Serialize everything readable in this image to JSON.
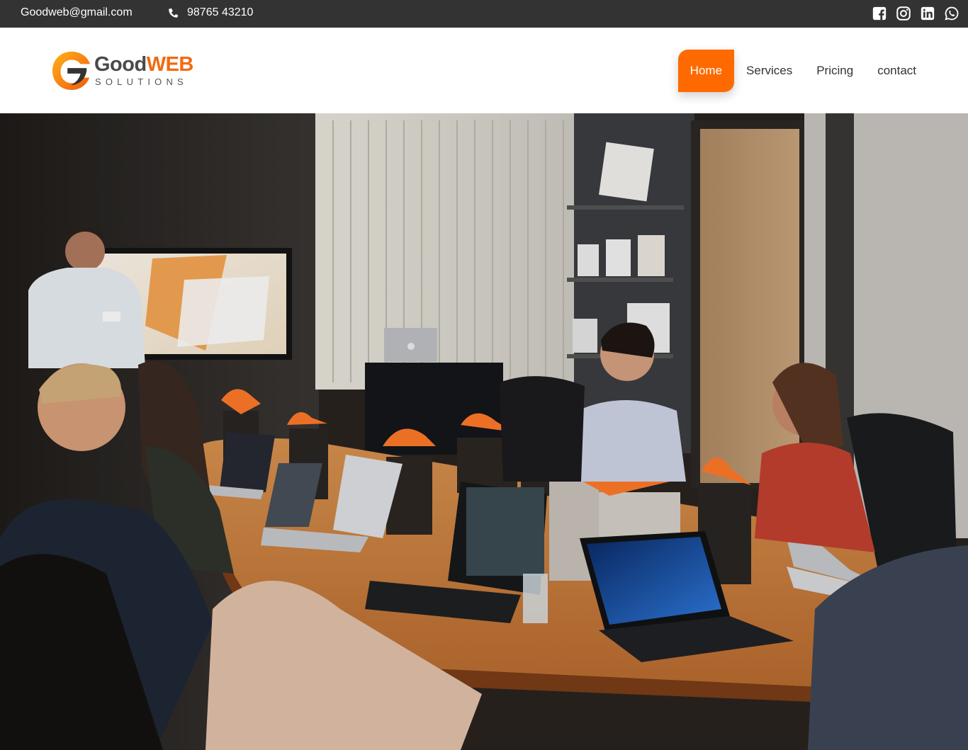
{
  "topbar": {
    "email": "Goodweb@gmail.com",
    "phone": "98765 43210",
    "social": [
      {
        "icon": "facebook-icon"
      },
      {
        "icon": "instagram-icon"
      },
      {
        "icon": "linkedin-icon"
      },
      {
        "icon": "whatsapp-icon"
      }
    ]
  },
  "logo": {
    "name_part1": "Good",
    "name_part2": "WEB",
    "tagline": "SOLUTIONS"
  },
  "nav": {
    "items": [
      {
        "label": "Home",
        "active": true
      },
      {
        "label": "Services",
        "active": false
      },
      {
        "label": "Pricing",
        "active": false
      },
      {
        "label": "contact",
        "active": false
      }
    ]
  },
  "hero": {
    "image": "office-meeting-photo"
  },
  "colors": {
    "topbar_bg": "#333333",
    "accent": "#ff6a00",
    "logo_orange": "#f26a10"
  }
}
